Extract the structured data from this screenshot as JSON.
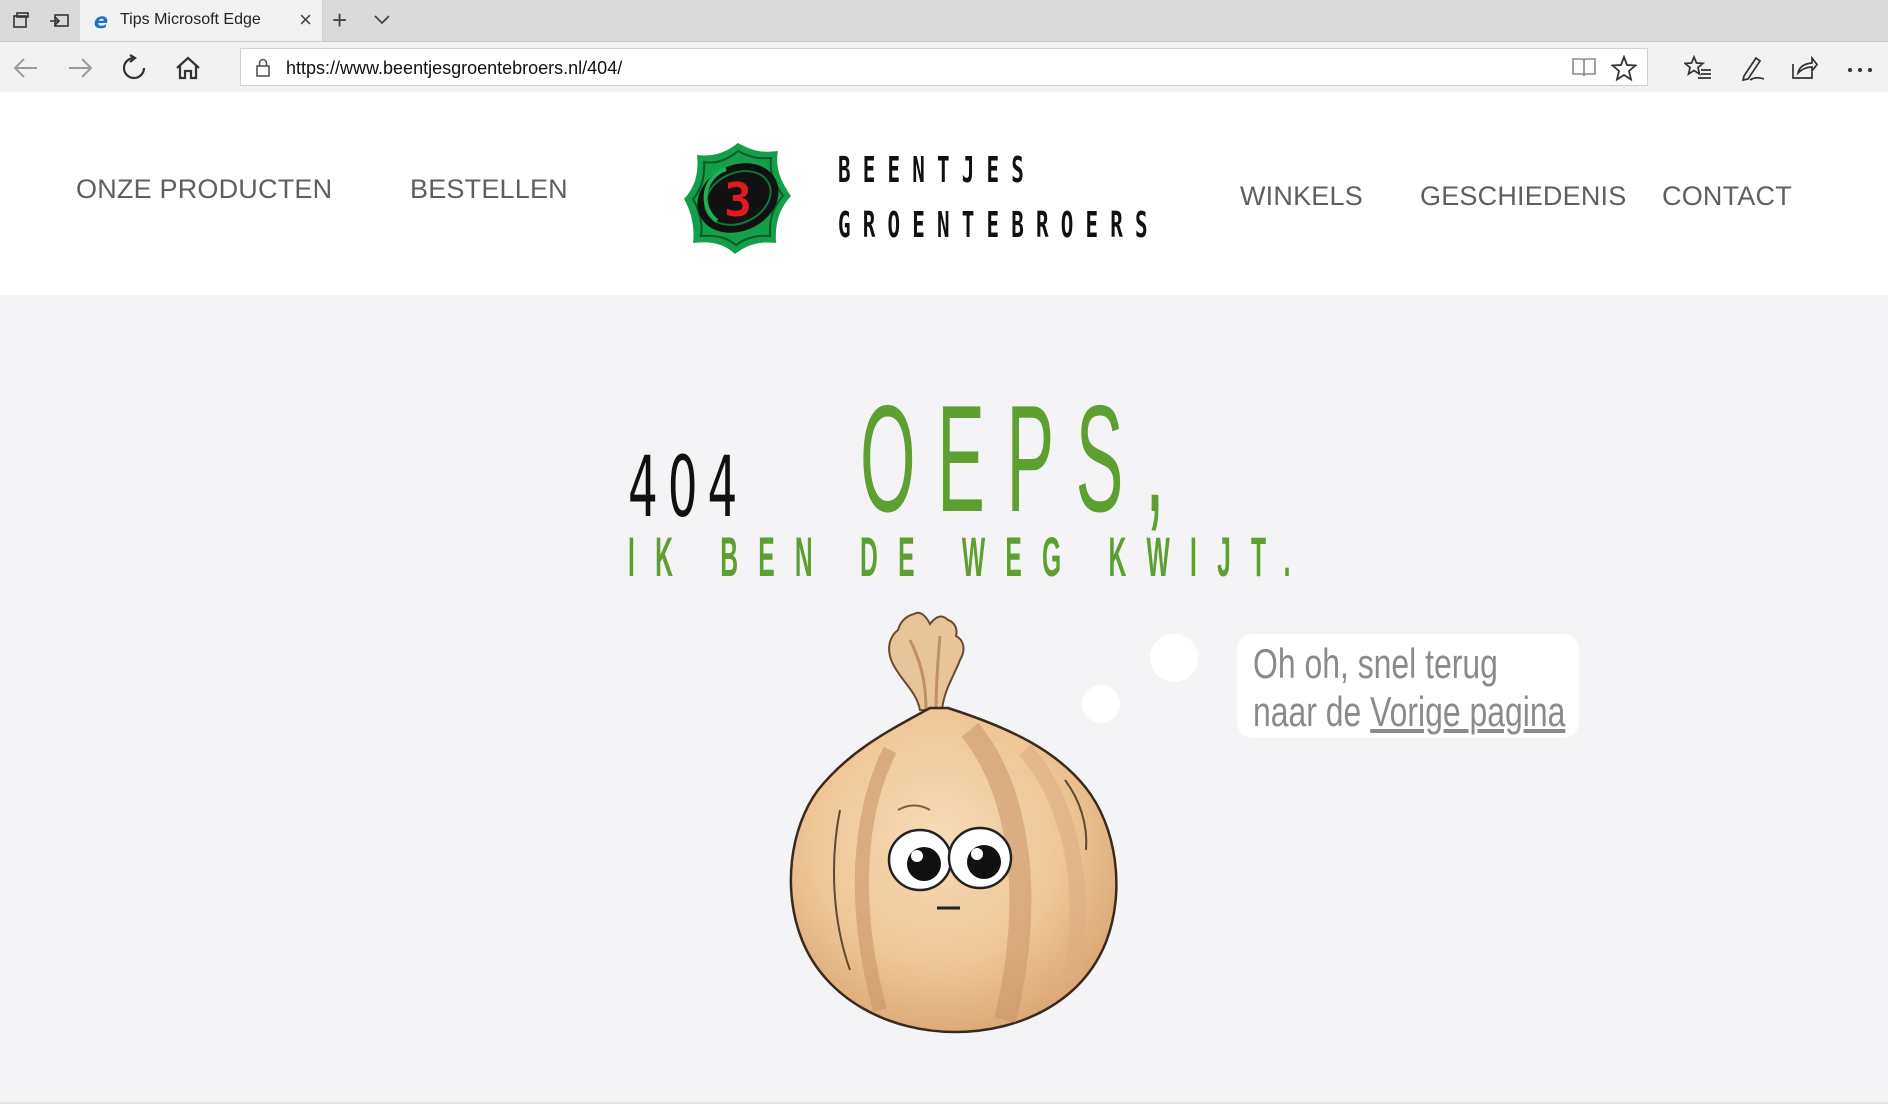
{
  "browser": {
    "tab_title": "Tips Microsoft Edge",
    "tab_close": "×",
    "new_tab": "+",
    "url": "https://www.beentjesgroentebroers.nl/404/"
  },
  "site": {
    "brand_line1": "BEENTJES",
    "brand_line2": "GROENTEBROERS",
    "logo_glyph": "3",
    "nav": {
      "producten": "ONZE PRODUCTEN",
      "bestellen": "BESTELLEN",
      "winkels": "WINKELS",
      "geschiedenis": "GESCHIEDENIS",
      "contact": "CONTACT"
    }
  },
  "error": {
    "code": "404",
    "heading": "OEPS,",
    "subtitle": "IK BEN DE WEG KWIJT.",
    "bubble_line1": "Oh oh, snel terug",
    "bubble_line2_prefix": "naar de ",
    "bubble_link": "Vorige pagina"
  },
  "colors": {
    "accent_green": "#5d9f31",
    "background": "#f4f4f6"
  }
}
